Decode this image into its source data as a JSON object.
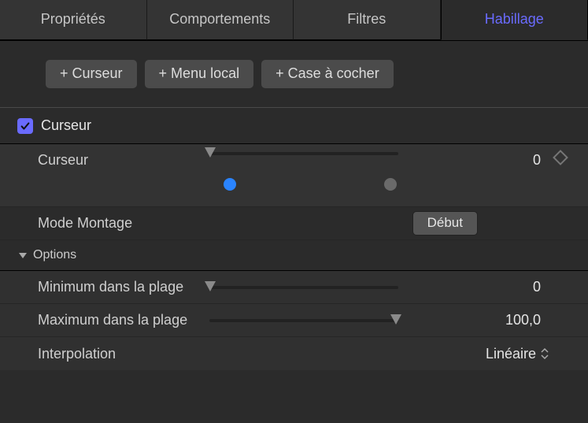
{
  "tabs": {
    "items": [
      {
        "label": "Propriétés"
      },
      {
        "label": "Comportements"
      },
      {
        "label": "Filtres"
      },
      {
        "label": "Habillage"
      }
    ],
    "active_index": 3
  },
  "add_buttons": {
    "curseur": "+ Curseur",
    "menu_local": "+ Menu local",
    "case_a_cocher": "+ Case à cocher"
  },
  "section": {
    "checked": true,
    "title": "Curseur"
  },
  "params": {
    "curseur_label": "Curseur",
    "curseur_value": "0",
    "mode_montage_label": "Mode Montage",
    "mode_montage_btn": "Début",
    "options_label": "Options",
    "min_label": "Minimum dans la plage",
    "min_value": "0",
    "max_label": "Maximum dans la plage",
    "max_value": "100,0",
    "interp_label": "Interpolation",
    "interp_value": "Linéaire"
  },
  "colors": {
    "accent": "#6a6bff"
  }
}
